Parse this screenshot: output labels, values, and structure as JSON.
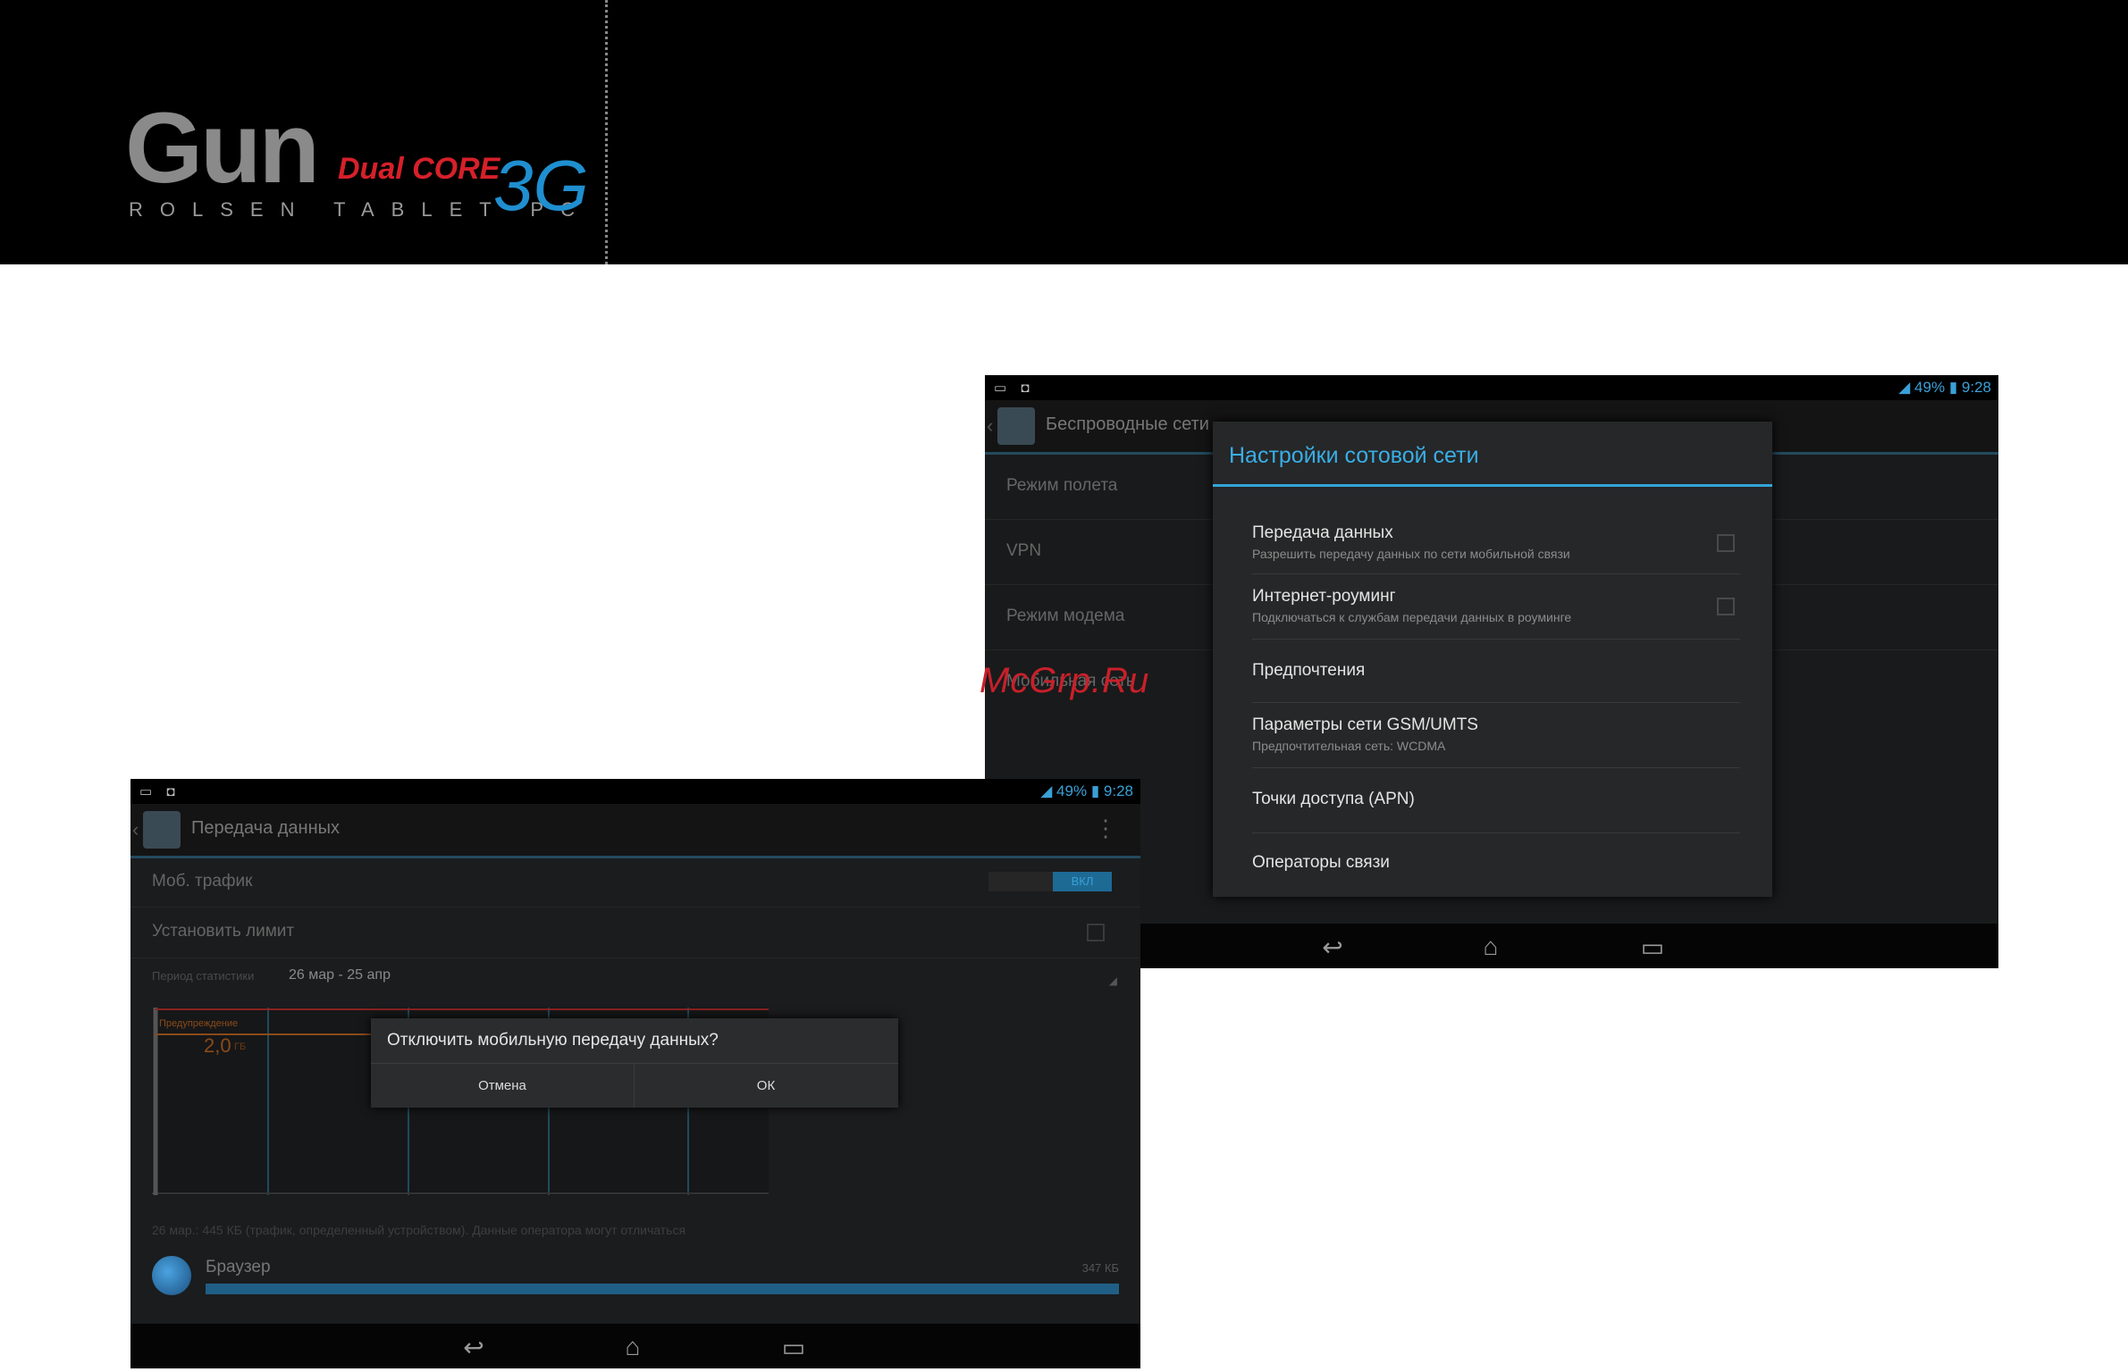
{
  "logo": {
    "brand": "Gun",
    "edition": "Dual CORE",
    "subtitle": "ROLSEN TABLET PC",
    "network": "3G"
  },
  "watermark": "McGrp.Ru",
  "colors": {
    "accent": "#33a5d8",
    "brand_red": "#d6202a",
    "brand_blue": "#1f8fd0"
  },
  "screen_cell": {
    "status": {
      "left_icons": "▭ ◘",
      "battery": "49%",
      "time": "9:28"
    },
    "actionbar_title": "Беспроводные сети",
    "background_rows": [
      "Режим полета",
      "VPN",
      "Режим модема",
      "Мобильная сеть"
    ],
    "dialog": {
      "title": "Настройки сотовой сети",
      "items": [
        {
          "title": "Передача данных",
          "summary": "Разрешить передачу данных по сети мобильной связи",
          "checkbox": true
        },
        {
          "title": "Интернет-роуминг",
          "summary": "Подключаться к службам передачи данных в роуминге",
          "checkbox": true
        },
        {
          "title": "Предпочтения",
          "summary": "",
          "checkbox": false
        },
        {
          "title": "Параметры сети GSM/UMTS",
          "summary": "Предпочтительная сеть: WCDMA",
          "checkbox": false
        },
        {
          "title": "Точки доступа (APN)",
          "summary": "",
          "checkbox": false
        },
        {
          "title": "Операторы связи",
          "summary": "",
          "checkbox": false
        }
      ]
    },
    "nav": {
      "back": "↩",
      "home": "⌂",
      "recent": "▭"
    }
  },
  "screen_data": {
    "status": {
      "left_icons": "▭ ◘",
      "battery": "49%",
      "time": "9:28"
    },
    "actionbar_title": "Передача данных",
    "rows": {
      "mobile_traffic": "Моб. трафик",
      "toggle_state": "ВКЛ",
      "set_limit": "Установить лимит",
      "period_label": "Период статистики",
      "period_value": "26 мар - 25 апр"
    },
    "chart": {
      "warning_label": "Предупреждение",
      "warning_value": "2,0",
      "warning_unit": "ГБ"
    },
    "dialog": {
      "message": "Отключить мобильную передачу данных?",
      "cancel": "Отмена",
      "ok": "ОК"
    },
    "usage_note": "26 мар.: 445 КБ (трафик, определенный устройством). Данные оператора могут отличаться",
    "app": {
      "name": "Браузер",
      "size": "347 КБ"
    },
    "nav": {
      "back": "↩",
      "home": "⌂",
      "recent": "▭"
    }
  }
}
